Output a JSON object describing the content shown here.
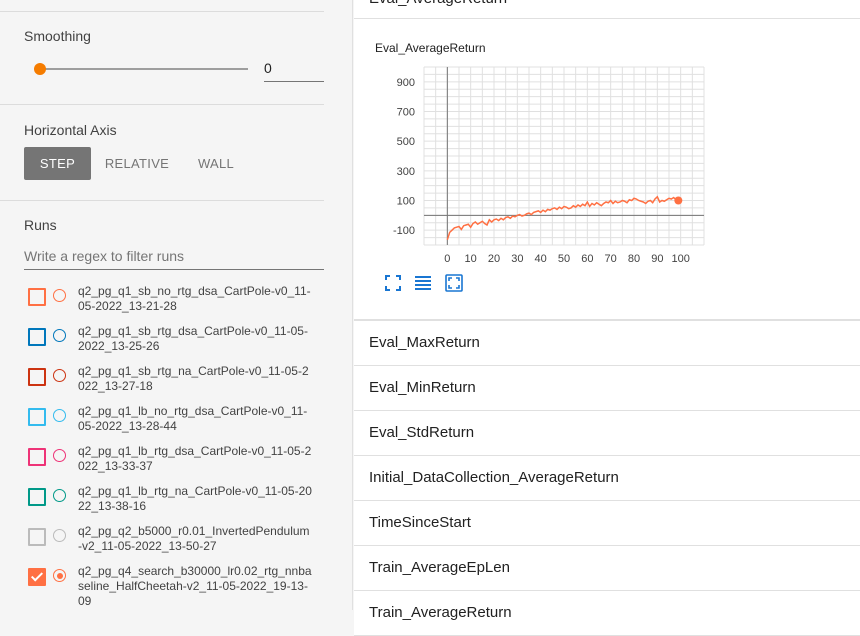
{
  "sidebar": {
    "smoothing": {
      "title": "Smoothing",
      "value": "0",
      "slider_fraction": 0
    },
    "horizontal_axis": {
      "title": "Horizontal Axis",
      "options": [
        "STEP",
        "RELATIVE",
        "WALL"
      ],
      "selected": "STEP"
    },
    "runs": {
      "title": "Runs",
      "filter_placeholder": "Write a regex to filter runs",
      "items": [
        {
          "label": "q2_pg_q1_sb_no_rtg_dsa_CartPole-v0_11-05-2022_13-21-28",
          "line1": "q2_pg_q1_sb_no_rtg_dsa_CartPole-v0_11-",
          "line2": "05-2022_13-21-28",
          "line3": "",
          "color": "#ff7043",
          "checked": false
        },
        {
          "label": "q2_pg_q1_sb_rtg_dsa_CartPole-v0_11-05-2022_13-25-26",
          "line1": "q2_pg_q1_sb_rtg_dsa_CartPole-v0_11-05-",
          "line2": "2022_13-25-26",
          "line3": "",
          "color": "#0077bb",
          "checked": false
        },
        {
          "label": "q2_pg_q1_sb_rtg_na_CartPole-v0_11-05-2022_13-27-18",
          "line1": "q2_pg_q1_sb_rtg_na_CartPole-v0_11-05-2",
          "line2": "022_13-27-18",
          "line3": "",
          "color": "#cc3311",
          "checked": false
        },
        {
          "label": "q2_pg_q1_lb_no_rtg_dsa_CartPole-v0_11-05-2022_13-28-44",
          "line1": "q2_pg_q1_lb_no_rtg_dsa_CartPole-v0_11-",
          "line2": "05-2022_13-28-44",
          "line3": "",
          "color": "#33bbee",
          "checked": false
        },
        {
          "label": "q2_pg_q1_lb_rtg_dsa_CartPole-v0_11-05-2022_13-33-37",
          "line1": "q2_pg_q1_lb_rtg_dsa_CartPole-v0_11-05-2",
          "line2": "022_13-33-37",
          "line3": "",
          "color": "#ee3377",
          "checked": false
        },
        {
          "label": "q2_pg_q1_lb_rtg_na_CartPole-v0_11-05-2022_13-38-16",
          "line1": "q2_pg_q1_lb_rtg_na_CartPole-v0_11-05-20",
          "line2": "22_13-38-16",
          "line3": "",
          "color": "#009988",
          "checked": false
        },
        {
          "label": "q2_pg_q2_b5000_r0.01_InvertedPendulum-v2_11-05-2022_13-50-27",
          "line1": "q2_pg_q2_b5000_r0.01_InvertedPendulum",
          "line2": "-v2_11-05-2022_13-50-27",
          "line3": "",
          "color": "#bbbbbb",
          "checked": false
        },
        {
          "label": "q2_pg_q4_search_b30000_lr0.02_rtg_nnbaseline_HalfCheetah-v2_11-05-2022_19-13-09",
          "line1": "q2_pg_q4_search_b30000_lr0.02_rtg_nnba",
          "line2": "seline_HalfCheetah-v2_11-05-2022_19-13-",
          "line3": "09",
          "color": "#ff7043",
          "checked": true
        }
      ]
    }
  },
  "main": {
    "top_card_title": "Eval_AverageReturn",
    "chart_card_title": "Eval_AverageReturn",
    "cards": [
      "Eval_MaxReturn",
      "Eval_MinReturn",
      "Eval_StdReturn",
      "Initial_DataCollection_AverageReturn",
      "TimeSinceStart",
      "Train_AverageEpLen",
      "Train_AverageReturn"
    ]
  },
  "chart_data": {
    "type": "line",
    "title": "Eval_AverageReturn",
    "xlabel": "",
    "ylabel": "",
    "xlim": [
      -10,
      110
    ],
    "ylim": [
      -200,
      1000
    ],
    "xticks": [
      0,
      10,
      20,
      30,
      40,
      50,
      60,
      70,
      80,
      90,
      100
    ],
    "yticks": [
      -100,
      100,
      300,
      500,
      700,
      900
    ],
    "grid": true,
    "colors": {
      "series": "#ff7043",
      "axis": "#757575",
      "grid": "#e0e0e0"
    },
    "series": [
      {
        "x": [
          0,
          1,
          2,
          3,
          4,
          5,
          6,
          7,
          8,
          9,
          10,
          11,
          12,
          13,
          14,
          15,
          16,
          17,
          18,
          19,
          20,
          21,
          22,
          23,
          24,
          25,
          26,
          27,
          28,
          29,
          30,
          31,
          32,
          33,
          34,
          35,
          36,
          37,
          38,
          39,
          40,
          41,
          42,
          43,
          44,
          45,
          46,
          47,
          48,
          49,
          50,
          51,
          52,
          53,
          54,
          55,
          56,
          57,
          58,
          59,
          60,
          61,
          62,
          63,
          64,
          65,
          66,
          67,
          68,
          69,
          70,
          71,
          72,
          73,
          74,
          75,
          76,
          77,
          78,
          79,
          80,
          81,
          82,
          83,
          84,
          85,
          86,
          87,
          88,
          89,
          90,
          91,
          92,
          93,
          94,
          95,
          96,
          97,
          98,
          99
        ],
        "values": [
          -165,
          -115,
          -100,
          -85,
          -80,
          -75,
          -95,
          -70,
          -65,
          -60,
          -80,
          -55,
          -45,
          -60,
          -50,
          -40,
          -55,
          -65,
          -30,
          -45,
          -30,
          -25,
          -35,
          -20,
          -30,
          -15,
          -10,
          -20,
          -5,
          -10,
          0,
          5,
          -5,
          0,
          10,
          15,
          5,
          20,
          25,
          30,
          20,
          35,
          25,
          40,
          35,
          45,
          50,
          40,
          55,
          45,
          60,
          55,
          45,
          50,
          65,
          55,
          70,
          60,
          75,
          65,
          90,
          60,
          80,
          70,
          85,
          75,
          65,
          80,
          90,
          85,
          100,
          80,
          95,
          85,
          90,
          100,
          95,
          85,
          105,
          100,
          115,
          110,
          100,
          95,
          90,
          80,
          95,
          100,
          85,
          110,
          125,
          90,
          100,
          95,
          105,
          115,
          110,
          120,
          105,
          100
        ]
      }
    ]
  }
}
